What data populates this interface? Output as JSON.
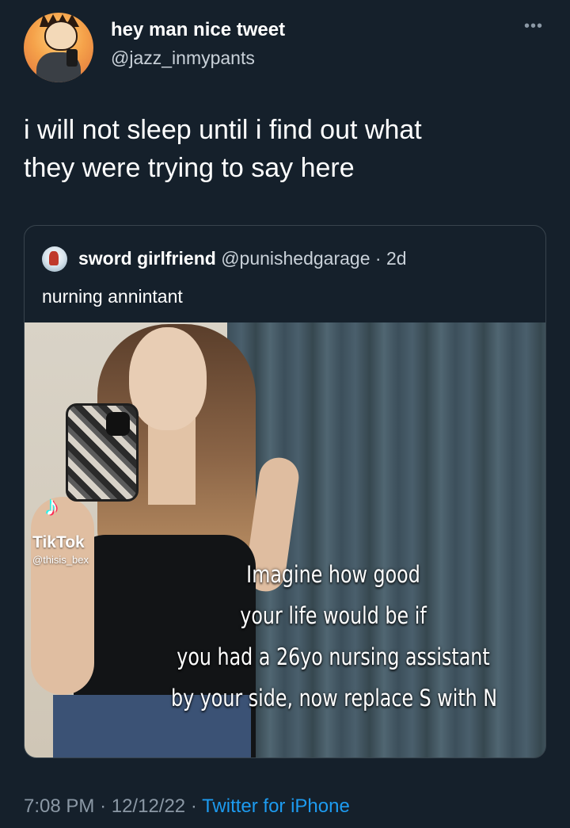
{
  "author": {
    "display_name": "hey man nice tweet",
    "handle": "@jazz_inmypants"
  },
  "tweet": {
    "text_line1": "i will not sleep until i find out what",
    "text_line2": "they were trying to say here"
  },
  "quoted_tweet": {
    "display_name": "sword girlfriend",
    "handle": "@punishedgarage",
    "separator": "·",
    "time_ago": "2d",
    "text": "nurning annintant",
    "media": {
      "watermark_brand": "TikTok",
      "watermark_user": "@thisis_bex",
      "caption_lines": [
        "Imagine how good",
        "your life would be if",
        "you had a 26yo nursing assistant",
        "by your side, now replace S with N"
      ]
    }
  },
  "footer": {
    "time": "7:08 PM",
    "separator": "·",
    "date": "12/12/22",
    "separator2": "·",
    "source": "Twitter for iPhone"
  },
  "icons": {
    "more": "more-icon",
    "tiktok": "tiktok-icon"
  }
}
